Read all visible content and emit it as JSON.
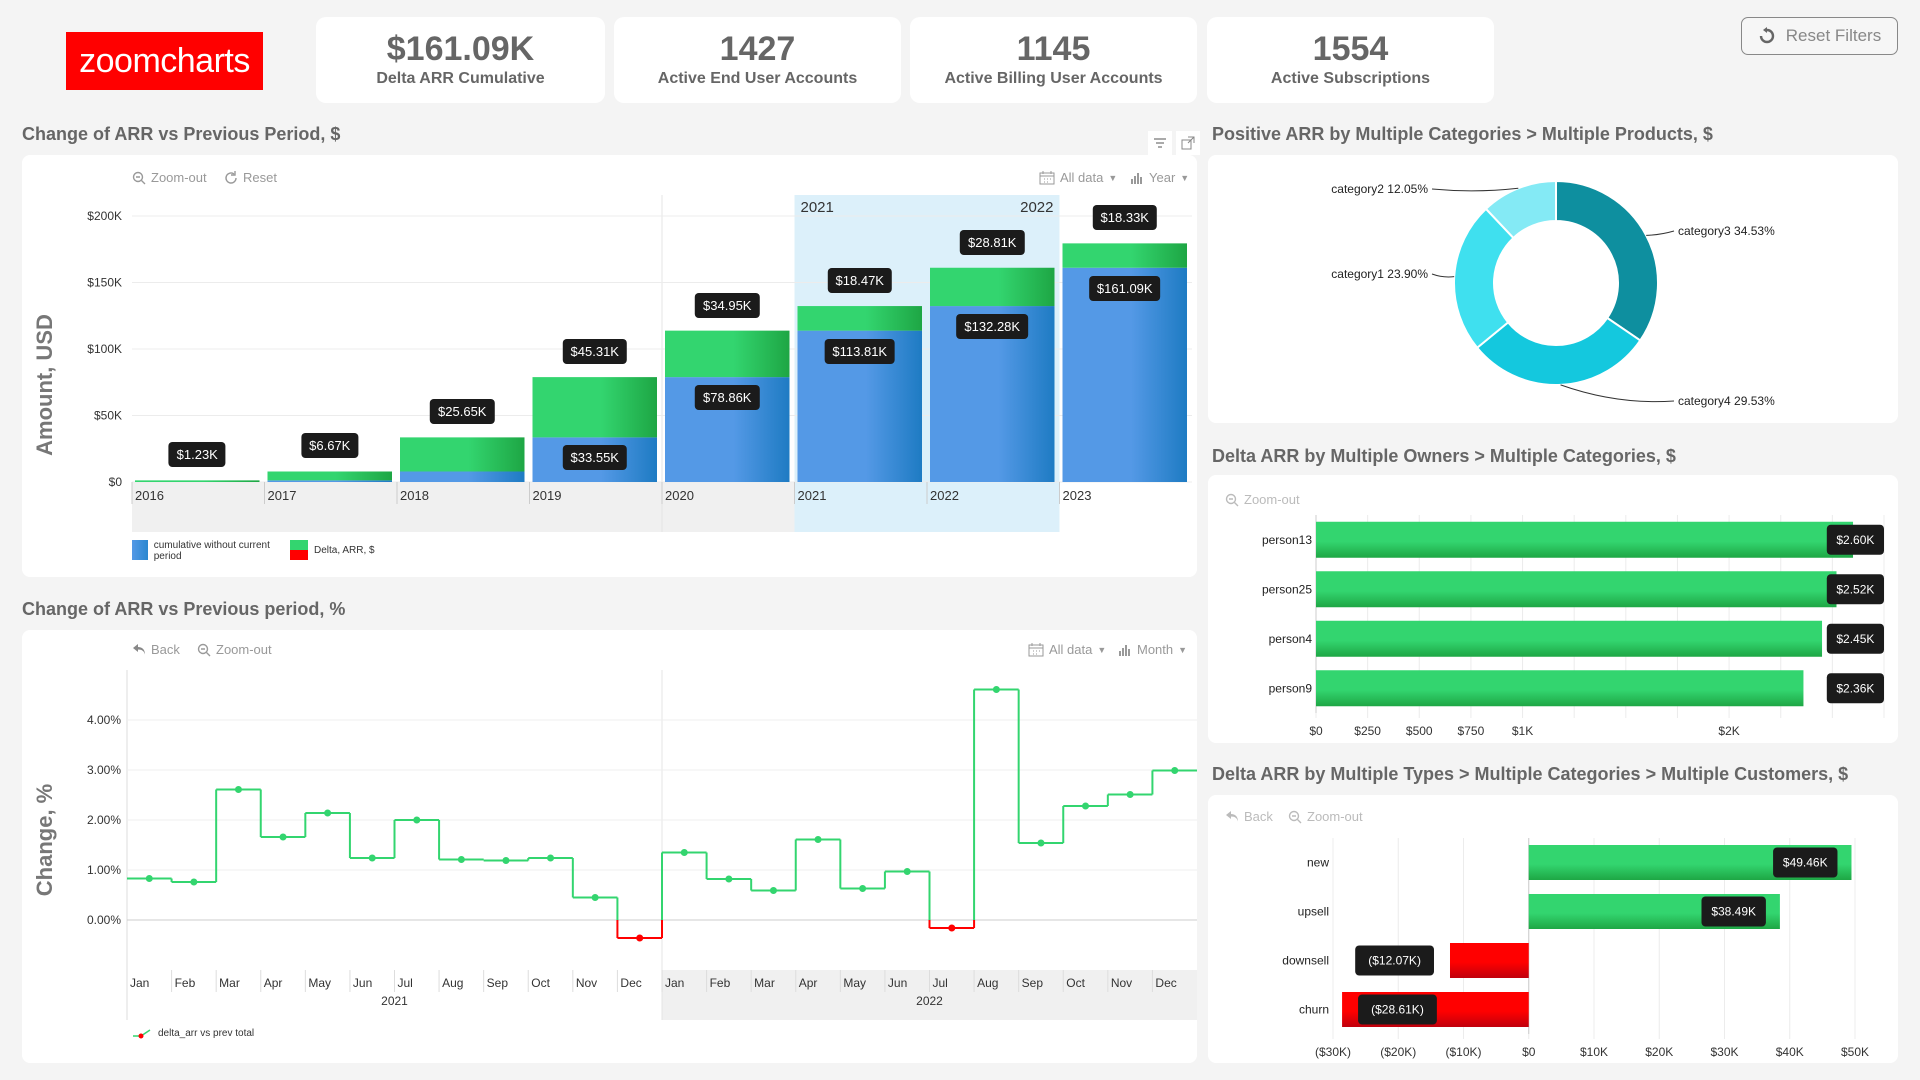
{
  "logo": {
    "text": "zoomcharts",
    "color": "#ff0000"
  },
  "kpis": [
    {
      "value": "$161.09K",
      "label": "Delta ARR Cumulative"
    },
    {
      "value": "1427",
      "label": "Active End User Accounts"
    },
    {
      "value": "1145",
      "label": "Active Billing User Accounts"
    },
    {
      "value": "1554",
      "label": "Active Subscriptions"
    }
  ],
  "reset_filters": {
    "label": "Reset Filters",
    "icon": "reset-icon"
  },
  "colors": {
    "green": "#33d56f",
    "green_dark": "#1ea644",
    "blue": "#5499e6",
    "blue_dark": "#1e7bc3",
    "red": "#ff0000",
    "teal1": "#3fe0ef",
    "teal2": "#84eaf5",
    "teal3": "#0e8f9f",
    "teal4": "#14c8de",
    "highlight": "#dcf0fa"
  },
  "panel1": {
    "title": "Change of ARR vs Previous Period, $",
    "toolbar": {
      "zoom_out": "Zoom-out",
      "reset": "Reset",
      "all_data": "All data",
      "period": "Year"
    },
    "icons": {
      "filter": "filter-icon",
      "expand": "expand-icon"
    },
    "yaxis_title": "Amount, USD",
    "legend": [
      {
        "label": "cumulative without current period"
      },
      {
        "label": "Delta, ARR, $"
      }
    ],
    "highlight_labels": [
      "2021",
      "2022"
    ]
  },
  "panel2": {
    "title": "Change of ARR vs Previous period, %",
    "toolbar": {
      "back": "Back",
      "zoom_out": "Zoom-out",
      "all_data": "All data",
      "period": "Month"
    },
    "yaxis_title": "Change, %",
    "legend": [
      {
        "label": "delta_arr vs prev total"
      }
    ]
  },
  "panel3": {
    "title": "Positive ARR by Multiple Categories > Multiple Products, $"
  },
  "panel4": {
    "title": "Delta ARR by Multiple Owners > Multiple Categories, $",
    "toolbar": {
      "zoom_out": "Zoom-out"
    }
  },
  "panel5": {
    "title": "Delta ARR by Multiple Types > Multiple Categories > Multiple Customers, $",
    "toolbar": {
      "back": "Back",
      "zoom_out": "Zoom-out"
    }
  },
  "chart_data": [
    {
      "type": "bar",
      "title": "Change of ARR vs Previous Period, $",
      "ylabel": "Amount, USD",
      "categories": [
        "2016",
        "2017",
        "2018",
        "2019",
        "2020",
        "2021",
        "2022",
        "2023"
      ],
      "series": [
        {
          "name": "cumulative without current period",
          "values": [
            0,
            1230,
            7900,
            33550,
            78860,
            113810,
            132280,
            161090
          ],
          "labels": [
            "",
            "",
            "",
            "$33.55K",
            "$78.86K",
            "$113.81K",
            "$132.28K",
            "$161.09K"
          ]
        },
        {
          "name": "Delta, ARR, $",
          "values": [
            1230,
            6670,
            25650,
            45310,
            34950,
            18470,
            28810,
            18330
          ],
          "labels": [
            "$1.23K",
            "$6.67K",
            "$25.65K",
            "$45.31K",
            "$34.95K",
            "$18.47K",
            "$28.81K",
            "$18.33K"
          ]
        }
      ],
      "yticks": [
        "$0",
        "$50K",
        "$100K",
        "$150K",
        "$200K"
      ],
      "ytick_values": [
        0,
        50000,
        100000,
        150000,
        200000
      ],
      "ylim": [
        0,
        200000
      ],
      "stacked": true,
      "highlight_range": [
        "2021",
        "2022"
      ]
    },
    {
      "type": "line",
      "step": true,
      "title": "Change of ARR vs Previous period, %",
      "ylabel": "Change, %",
      "x": [
        "Jan",
        "Feb",
        "Mar",
        "Apr",
        "May",
        "Jun",
        "Jul",
        "Aug",
        "Sep",
        "Oct",
        "Nov",
        "Dec",
        "Jan",
        "Feb",
        "Mar",
        "Apr",
        "May",
        "Jun",
        "Jul",
        "Aug",
        "Sep",
        "Oct",
        "Nov",
        "Dec"
      ],
      "x_groups": [
        {
          "label": "2021",
          "count": 12
        },
        {
          "label": "2022",
          "count": 12
        }
      ],
      "series": [
        {
          "name": "delta_arr vs prev total",
          "values": [
            0.83,
            0.76,
            2.61,
            1.66,
            2.14,
            1.24,
            2.0,
            1.21,
            1.19,
            1.24,
            0.45,
            -0.36,
            1.35,
            0.82,
            0.59,
            1.61,
            0.63,
            0.97,
            -0.16,
            4.61,
            1.54,
            2.28,
            2.51,
            2.99
          ]
        }
      ],
      "yticks": [
        "0.00%",
        "1.00%",
        "2.00%",
        "3.00%",
        "4.00%"
      ],
      "ytick_values": [
        0,
        1,
        2,
        3,
        4
      ],
      "ylim": [
        -1.0,
        5.0
      ]
    },
    {
      "type": "pie",
      "donut": true,
      "title": "Positive ARR by Multiple Categories > Multiple Products, $",
      "slices": [
        {
          "label": "category3",
          "pct": "34.53%",
          "value": 34.53
        },
        {
          "label": "category4",
          "pct": "29.53%",
          "value": 29.53
        },
        {
          "label": "category1",
          "pct": "23.90%",
          "value": 23.9
        },
        {
          "label": "category2",
          "pct": "12.05%",
          "value": 12.05
        }
      ]
    },
    {
      "type": "bar",
      "orientation": "horizontal",
      "title": "Delta ARR by Multiple Owners > Multiple Categories, $",
      "categories": [
        "person13",
        "person25",
        "person4",
        "person9"
      ],
      "values": [
        2600,
        2520,
        2450,
        2360
      ],
      "labels": [
        "$2.60K",
        "$2.52K",
        "$2.45K",
        "$2.36K"
      ],
      "xticks": [
        "$0",
        "$250",
        "$500",
        "$750",
        "$1K",
        "$2K"
      ],
      "xtick_values": [
        0,
        250,
        500,
        750,
        1000,
        2000
      ],
      "xlim": [
        0,
        2750
      ]
    },
    {
      "type": "bar",
      "orientation": "horizontal",
      "title": "Delta ARR by Multiple Types > Multiple Categories > Multiple Customers, $",
      "categories": [
        "new",
        "upsell",
        "downsell",
        "churn"
      ],
      "values": [
        49460,
        38490,
        -12070,
        -28610
      ],
      "labels": [
        "$49.46K",
        "$38.49K",
        "($12.07K)",
        "($28.61K)"
      ],
      "xticks": [
        "($30K)",
        "($20K)",
        "($10K)",
        "$0",
        "$10K",
        "$20K",
        "$30K",
        "$40K",
        "$50K"
      ],
      "xtick_values": [
        -30000,
        -20000,
        -10000,
        0,
        10000,
        20000,
        30000,
        40000,
        50000
      ],
      "xlim": [
        -30000,
        50000
      ]
    }
  ]
}
